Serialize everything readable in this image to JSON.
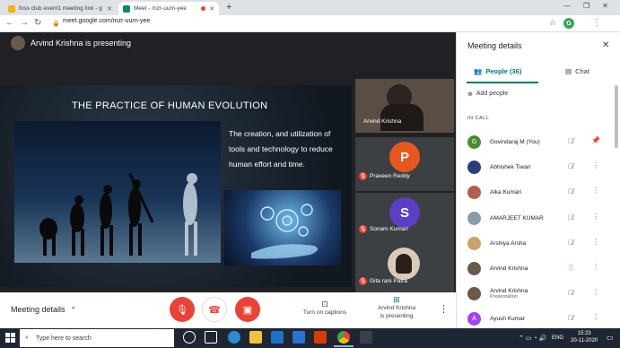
{
  "browser": {
    "tabs": [
      {
        "title": "foss club event1 meeting link - g",
        "active": false
      },
      {
        "title": "Meet - mzr-uurn-yee",
        "active": true
      }
    ],
    "new_tab": "+",
    "url": "meet.google.com/mzr-uurn-yee",
    "profile_initial": "G"
  },
  "meeting": {
    "presenting_banner": "Arvind Krishna is presenting",
    "slide": {
      "title": "THE PRACTICE OF HUMAN EVOLUTION",
      "text": "The creation, and utilization of tools and technology to reduce human effort and time."
    },
    "tiles": [
      {
        "name": "Arvind Krishna",
        "initial": "",
        "color": "#6b5a4a"
      },
      {
        "name": "Praveen Reddy",
        "initial": "P",
        "color": "#e8571e"
      },
      {
        "name": "Sonam Kumari",
        "initial": "S",
        "color": "#5b3fc4"
      },
      {
        "name": "Gita rani Patra",
        "initial": "",
        "color": "#7a6a5a"
      }
    ],
    "bottom": {
      "meeting_details": "Meeting details",
      "captions": "Turn on captions",
      "presenting": "Arvind Krishna\nis presenting",
      "presenting_line1": "Arvind Krishna",
      "presenting_line2": "is presenting"
    }
  },
  "panel": {
    "title": "Meeting details",
    "tab_people": "People (36)",
    "tab_chat": "Chat",
    "add_people": "Add people",
    "section": "IN CALL",
    "people": [
      {
        "name": "Govindaraj M (You)",
        "sub": "",
        "initial": "G",
        "color": "#4e8a2f",
        "action": "pin"
      },
      {
        "name": "Abhishek Tiwari",
        "sub": "",
        "initial": "",
        "color": "#2b3e7a",
        "action": "more"
      },
      {
        "name": "Alka Kumari",
        "sub": "",
        "initial": "",
        "color": "#b05f50",
        "action": "more"
      },
      {
        "name": "AMARJEET KUMAR",
        "sub": "",
        "initial": "",
        "color": "#8a9aa8",
        "action": "more"
      },
      {
        "name": "Arshiya Arsha",
        "sub": "",
        "initial": "",
        "color": "#c9a46a",
        "action": "more"
      },
      {
        "name": "Arvind Krishna",
        "sub": "",
        "initial": "",
        "color": "#6b5a4a",
        "action": "more"
      },
      {
        "name": "Arvind Krishna",
        "sub": "Presentation",
        "initial": "",
        "color": "#6b5a4a",
        "action": "more"
      },
      {
        "name": "Ayush Kumar",
        "sub": "",
        "initial": "A",
        "color": "#a142f4",
        "action": "more"
      }
    ]
  },
  "taskbar": {
    "search_placeholder": "Type here to search",
    "lang": "ENG",
    "time": "15:23",
    "date": "20-11-2020"
  },
  "colors": {
    "meet_red": "#ea4335",
    "accent": "#00796b",
    "speaking": "#1ea7a0"
  }
}
